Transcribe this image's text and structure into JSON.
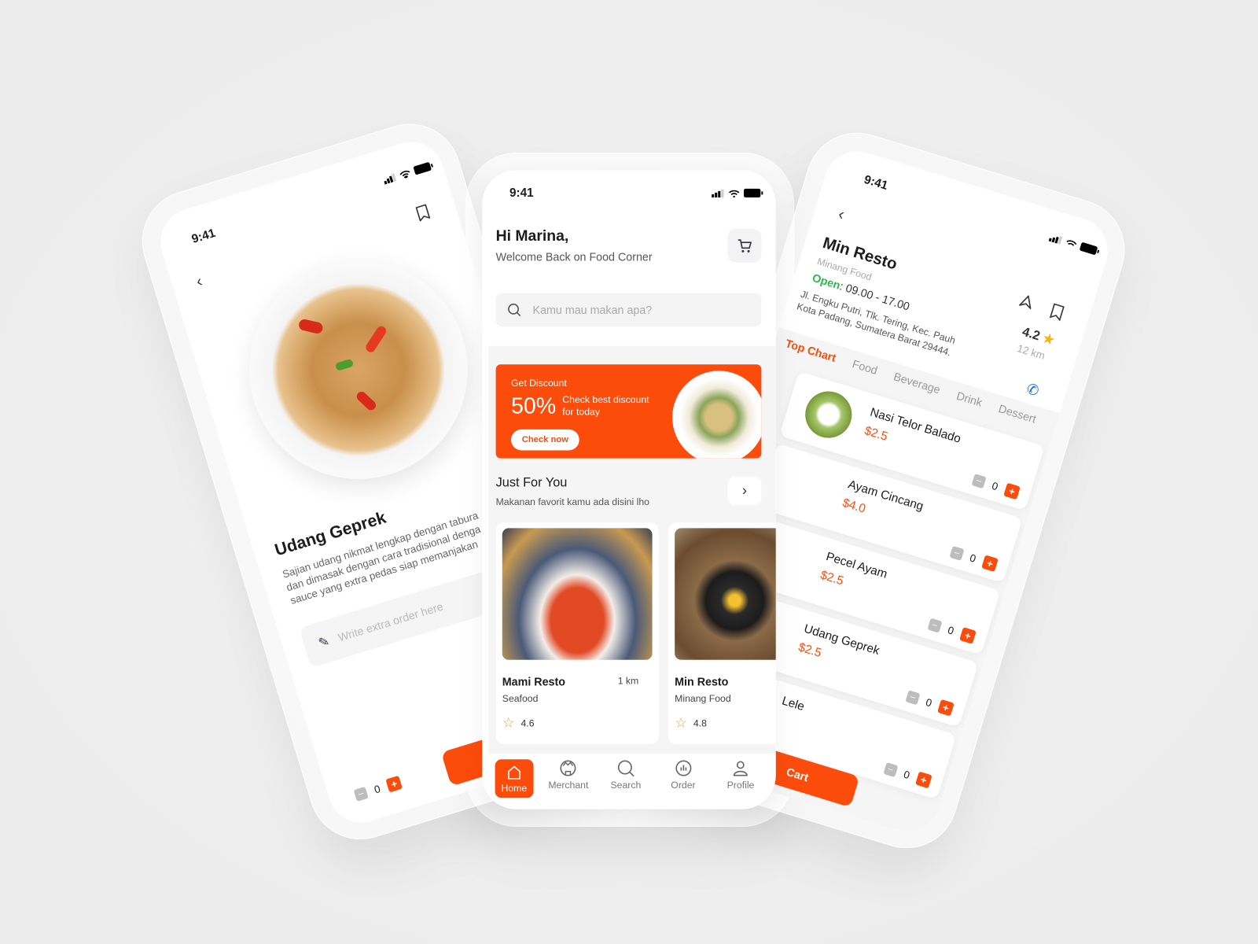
{
  "status_time": "9:41",
  "detail_screen": {
    "title": "Udang Geprek",
    "description": [
      "Sajian udang nikmat lengkap dengan tabura",
      "dan dimasak dengan cara tradisional denga",
      "sauce yang extra pedas siap memanjakan"
    ],
    "note_placeholder": "Write extra order here",
    "quantity": "0"
  },
  "home_screen": {
    "greeting": "Hi Marina,",
    "subtitle": "Welcome Back on Food Corner",
    "search_placeholder": "Kamu mau makan apa?",
    "banner": {
      "eyebrow": "Get Discount",
      "percent": "50%",
      "text1": "Check best discount",
      "text2": "for today",
      "button": "Check now"
    },
    "section": {
      "title": "Just For You",
      "subtitle": "Makanan favorit kamu ada disini lho"
    },
    "cards": [
      {
        "name": "Mami Resto",
        "distance": "1 km",
        "category": "Seafood",
        "rating": "4.6"
      },
      {
        "name": "Min Resto",
        "category": "Minang Food",
        "rating": "4.8"
      }
    ],
    "nav": [
      {
        "label": "Home",
        "icon": "home-icon",
        "active": true
      },
      {
        "label": "Merchant",
        "icon": "merchant-icon"
      },
      {
        "label": "Search",
        "icon": "search-icon"
      },
      {
        "label": "Order",
        "icon": "order-icon"
      },
      {
        "label": "Profile",
        "icon": "profile-icon"
      }
    ]
  },
  "resto_screen": {
    "name": "Min Resto",
    "category": "Minang Food",
    "open_label": "Open",
    "hours": ": 09.00 - 17.00",
    "address1": "Jl. Engku Putri, Tlk. Tering, Kec. Pauh",
    "address2": "Kota Padang, Sumatera Barat 29444.",
    "rating": "4.2",
    "distance": "12 km",
    "tabs": [
      "Top Chart",
      "Food",
      "Beverage",
      "Drink",
      "Dessert"
    ],
    "items": [
      {
        "name": "Nasi Telor Balado",
        "price": "$2.5",
        "qty": "0"
      },
      {
        "name": "Ayam Cincang",
        "price": "$4.0",
        "qty": "0"
      },
      {
        "name": "Pecel Ayam",
        "price": "$2.5",
        "qty": "0"
      },
      {
        "name": "Udang Geprek",
        "price": "$2.5",
        "qty": "0"
      },
      {
        "name": "Lele",
        "price": "",
        "qty": "0"
      }
    ],
    "cart_button": "Cart"
  },
  "colors": {
    "accent": "#fc4c0c",
    "open": "#2fb84f",
    "star": "#f5b50a",
    "call": "#1a6fe0"
  }
}
